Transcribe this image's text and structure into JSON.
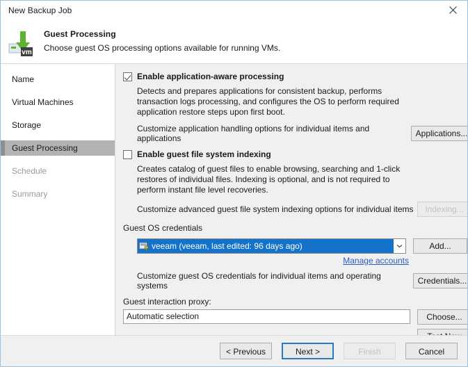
{
  "window": {
    "title": "New Backup Job",
    "close_icon": "close-icon"
  },
  "header": {
    "icon": "vm-backup-icon",
    "title": "Guest Processing",
    "subtitle": "Choose guest OS processing options available for running VMs."
  },
  "sidebar": {
    "items": [
      {
        "label": "Name",
        "state": "normal"
      },
      {
        "label": "Virtual Machines",
        "state": "normal"
      },
      {
        "label": "Storage",
        "state": "normal"
      },
      {
        "label": "Guest Processing",
        "state": "selected"
      },
      {
        "label": "Schedule",
        "state": "disabled"
      },
      {
        "label": "Summary",
        "state": "disabled"
      }
    ]
  },
  "main": {
    "app_aware": {
      "checkbox_label": "Enable application-aware processing",
      "checked": true,
      "description": "Detects and prepares applications for consistent backup, performs transaction logs processing, and configures the OS to perform required application restore steps upon first boot.",
      "customize_text": "Customize application handling options for individual items and applications",
      "button_label": "Applications..."
    },
    "indexing": {
      "checkbox_label": "Enable guest file system indexing",
      "checked": false,
      "description": "Creates catalog of guest files to enable browsing, searching and 1-click restores of individual files. Indexing is optional, and is not required to perform instant file level recoveries.",
      "customize_text": "Customize advanced guest file system indexing options for individual items",
      "button_label": "Indexing...",
      "button_disabled": true
    },
    "credentials": {
      "group_label": "Guest OS credentials",
      "selected_account": "veeam (veeam, last edited: 96 days ago)",
      "account_icon": "credential-icon",
      "dropdown_icon": "chevron-down-icon",
      "add_button": "Add...",
      "manage_link": "Manage accounts",
      "customize_text": "Customize guest OS credentials for individual items and operating systems",
      "credentials_button": "Credentials..."
    },
    "proxy": {
      "label": "Guest interaction proxy:",
      "value": "Automatic selection",
      "choose_button": "Choose...",
      "test_button": "Test Now"
    }
  },
  "footer": {
    "previous": "< Previous",
    "next": "Next >",
    "finish": "Finish",
    "cancel": "Cancel"
  },
  "colors": {
    "selection_blue": "#1473c8",
    "link_blue": "#2a5cc8",
    "focus_blue": "#2a78c8",
    "sidebar_selected": "#b3b3b3",
    "content_bg": "#f0f0f0",
    "icon_green": "#5cb331"
  }
}
